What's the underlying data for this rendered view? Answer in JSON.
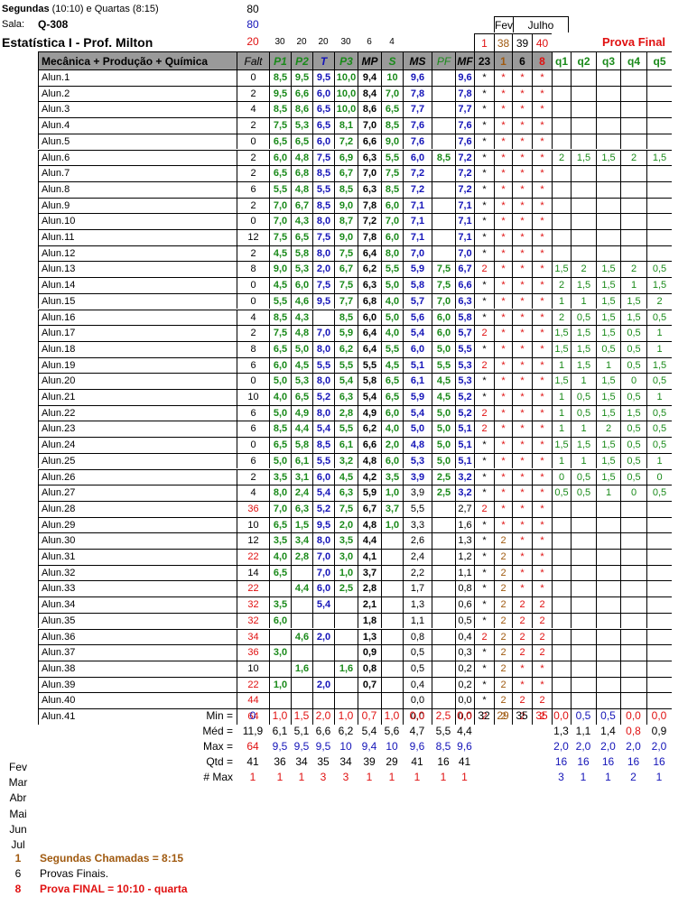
{
  "header": {
    "schedule_bold": "Segundas",
    "schedule_rest": "(10:10) e Quartas (8:15)",
    "hours": "80",
    "sala_label": "Sala:",
    "sala_value": "Q-308",
    "sala_count": "80",
    "course_title": "Estatística I - Prof. Milton",
    "course_count": "20",
    "weights": [
      "30",
      "20",
      "20",
      "30",
      "6",
      "4"
    ],
    "month_fev": "Fev",
    "month_jul": "Julho",
    "days": [
      "1",
      "38",
      "39",
      "40"
    ],
    "prova_final": "Prova Final",
    "class_name": "Mecânica + Produção + Química",
    "cols": [
      "Falt",
      "P1",
      "P2",
      "T",
      "P3",
      "MP",
      "S",
      "MS",
      "PF",
      "MF",
      "23",
      "1",
      "6",
      "8",
      "q1",
      "q2",
      "q3",
      "q4",
      "q5"
    ]
  },
  "students": [
    [
      "Alun.1",
      "0",
      "8,5",
      "9,5",
      "9,5",
      "10,0",
      "9,4",
      "10",
      "9,6",
      "",
      "9,6",
      "*",
      "*",
      "*",
      "*",
      "",
      "",
      "",
      "",
      ""
    ],
    [
      "Alun.2",
      "2",
      "9,5",
      "6,6",
      "6,0",
      "10,0",
      "8,4",
      "7,0",
      "7,8",
      "",
      "7,8",
      "*",
      "*",
      "*",
      "*",
      "",
      "",
      "",
      "",
      ""
    ],
    [
      "Alun.3",
      "4",
      "8,5",
      "8,6",
      "6,5",
      "10,0",
      "8,6",
      "6,5",
      "7,7",
      "",
      "7,7",
      "*",
      "*",
      "*",
      "*",
      "",
      "",
      "",
      "",
      ""
    ],
    [
      "Alun.4",
      "2",
      "7,5",
      "5,3",
      "6,5",
      "8,1",
      "7,0",
      "8,5",
      "7,6",
      "",
      "7,6",
      "*",
      "*",
      "*",
      "*",
      "",
      "",
      "",
      "",
      ""
    ],
    [
      "Alun.5",
      "0",
      "6,5",
      "6,5",
      "6,0",
      "7,2",
      "6,6",
      "9,0",
      "7,6",
      "",
      "7,6",
      "*",
      "*",
      "*",
      "*",
      "",
      "",
      "",
      "",
      ""
    ],
    [
      "Alun.6",
      "2",
      "6,0",
      "4,8",
      "7,5",
      "6,9",
      "6,3",
      "5,5",
      "6,0",
      "8,5",
      "7,2",
      "*",
      "*",
      "*",
      "*",
      "2",
      "1,5",
      "1,5",
      "2",
      "1,5"
    ],
    [
      "Alun.7",
      "2",
      "6,5",
      "6,8",
      "8,5",
      "6,7",
      "7,0",
      "7,5",
      "7,2",
      "",
      "7,2",
      "*",
      "*",
      "*",
      "*",
      "",
      "",
      "",
      "",
      ""
    ],
    [
      "Alun.8",
      "6",
      "5,5",
      "4,8",
      "5,5",
      "8,5",
      "6,3",
      "8,5",
      "7,2",
      "",
      "7,2",
      "*",
      "*",
      "*",
      "*",
      "",
      "",
      "",
      "",
      ""
    ],
    [
      "Alun.9",
      "2",
      "7,0",
      "6,7",
      "8,5",
      "9,0",
      "7,8",
      "6,0",
      "7,1",
      "",
      "7,1",
      "*",
      "*",
      "*",
      "*",
      "",
      "",
      "",
      "",
      ""
    ],
    [
      "Alun.10",
      "0",
      "7,0",
      "4,3",
      "8,0",
      "8,7",
      "7,2",
      "7,0",
      "7,1",
      "",
      "7,1",
      "*",
      "*",
      "*",
      "*",
      "",
      "",
      "",
      "",
      ""
    ],
    [
      "Alun.11",
      "12",
      "7,5",
      "6,5",
      "7,5",
      "9,0",
      "7,8",
      "6,0",
      "7,1",
      "",
      "7,1",
      "*",
      "*",
      "*",
      "*",
      "",
      "",
      "",
      "",
      ""
    ],
    [
      "Alun.12",
      "2",
      "4,5",
      "5,8",
      "8,0",
      "7,5",
      "6,4",
      "8,0",
      "7,0",
      "",
      "7,0",
      "*",
      "*",
      "*",
      "*",
      "",
      "",
      "",
      "",
      ""
    ],
    [
      "Alun.13",
      "8",
      "9,0",
      "5,3",
      "2,0",
      "6,7",
      "6,2",
      "5,5",
      "5,9",
      "7,5",
      "6,7",
      "2",
      "*",
      "*",
      "*",
      "1,5",
      "2",
      "1,5",
      "2",
      "0,5"
    ],
    [
      "Alun.14",
      "0",
      "4,5",
      "6,0",
      "7,5",
      "7,5",
      "6,3",
      "5,0",
      "5,8",
      "7,5",
      "6,6",
      "*",
      "*",
      "*",
      "*",
      "2",
      "1,5",
      "1,5",
      "1",
      "1,5"
    ],
    [
      "Alun.15",
      "0",
      "5,5",
      "4,6",
      "9,5",
      "7,7",
      "6,8",
      "4,0",
      "5,7",
      "7,0",
      "6,3",
      "*",
      "*",
      "*",
      "*",
      "1",
      "1",
      "1,5",
      "1,5",
      "2"
    ],
    [
      "Alun.16",
      "4",
      "8,5",
      "4,3",
      "",
      "8,5",
      "6,0",
      "5,0",
      "5,6",
      "6,0",
      "5,8",
      "*",
      "*",
      "*",
      "*",
      "2",
      "0,5",
      "1,5",
      "1,5",
      "0,5"
    ],
    [
      "Alun.17",
      "2",
      "7,5",
      "4,8",
      "7,0",
      "5,9",
      "6,4",
      "4,0",
      "5,4",
      "6,0",
      "5,7",
      "2",
      "*",
      "*",
      "*",
      "1,5",
      "1,5",
      "1,5",
      "0,5",
      "1"
    ],
    [
      "Alun.18",
      "8",
      "6,5",
      "5,0",
      "8,0",
      "6,2",
      "6,4",
      "5,5",
      "6,0",
      "5,0",
      "5,5",
      "*",
      "*",
      "*",
      "*",
      "1,5",
      "1,5",
      "0,5",
      "0,5",
      "1"
    ],
    [
      "Alun.19",
      "6",
      "6,0",
      "4,5",
      "5,5",
      "5,5",
      "5,5",
      "4,5",
      "5,1",
      "5,5",
      "5,3",
      "2",
      "*",
      "*",
      "*",
      "1",
      "1,5",
      "1",
      "0,5",
      "1,5"
    ],
    [
      "Alun.20",
      "0",
      "5,0",
      "5,3",
      "8,0",
      "5,4",
      "5,8",
      "6,5",
      "6,1",
      "4,5",
      "5,3",
      "*",
      "*",
      "*",
      "*",
      "1,5",
      "1",
      "1,5",
      "0",
      "0,5"
    ],
    [
      "Alun.21",
      "10",
      "4,0",
      "6,5",
      "5,2",
      "6,3",
      "5,4",
      "6,5",
      "5,9",
      "4,5",
      "5,2",
      "*",
      "*",
      "*",
      "*",
      "1",
      "0,5",
      "1,5",
      "0,5",
      "1"
    ],
    [
      "Alun.22",
      "6",
      "5,0",
      "4,9",
      "8,0",
      "2,8",
      "4,9",
      "6,0",
      "5,4",
      "5,0",
      "5,2",
      "2",
      "*",
      "*",
      "*",
      "1",
      "0,5",
      "1,5",
      "1,5",
      "0,5"
    ],
    [
      "Alun.23",
      "6",
      "8,5",
      "4,4",
      "5,4",
      "5,5",
      "6,2",
      "4,0",
      "5,0",
      "5,0",
      "5,1",
      "2",
      "*",
      "*",
      "*",
      "1",
      "1",
      "2",
      "0,5",
      "0,5"
    ],
    [
      "Alun.24",
      "0",
      "6,5",
      "5,8",
      "8,5",
      "6,1",
      "6,6",
      "2,0",
      "4,8",
      "5,0",
      "5,1",
      "*",
      "*",
      "*",
      "*",
      "1,5",
      "1,5",
      "1,5",
      "0,5",
      "0,5"
    ],
    [
      "Alun.25",
      "6",
      "5,0",
      "6,1",
      "5,5",
      "3,2",
      "4,8",
      "6,0",
      "5,3",
      "5,0",
      "5,1",
      "*",
      "*",
      "*",
      "*",
      "1",
      "1",
      "1,5",
      "0,5",
      "1"
    ],
    [
      "Alun.26",
      "2",
      "3,5",
      "3,1",
      "6,0",
      "4,5",
      "4,2",
      "3,5",
      "3,9",
      "2,5",
      "3,2",
      "*",
      "*",
      "*",
      "*",
      "0",
      "0,5",
      "1,5",
      "0,5",
      "0"
    ],
    [
      "Alun.27",
      "4",
      "8,0",
      "2,4",
      "5,4",
      "6,3",
      "5,9",
      "1,0",
      "3,9",
      "2,5",
      "3,2",
      "*",
      "*",
      "*",
      "*",
      "0,5",
      "0,5",
      "1",
      "0",
      "0,5"
    ],
    [
      "Alun.28",
      "36",
      "7,0",
      "6,3",
      "5,2",
      "7,5",
      "6,7",
      "3,7",
      "5,5",
      "",
      "2,7",
      "2",
      "*",
      "*",
      "*",
      "",
      "",
      "",
      "",
      ""
    ],
    [
      "Alun.29",
      "10",
      "6,5",
      "1,5",
      "9,5",
      "2,0",
      "4,8",
      "1,0",
      "3,3",
      "",
      "1,6",
      "*",
      "*",
      "*",
      "*",
      "",
      "",
      "",
      "",
      ""
    ],
    [
      "Alun.30",
      "12",
      "3,5",
      "3,4",
      "8,0",
      "3,5",
      "4,4",
      "",
      "2,6",
      "",
      "1,3",
      "*",
      "2",
      "*",
      "*",
      "",
      "",
      "",
      "",
      ""
    ],
    [
      "Alun.31",
      "22",
      "4,0",
      "2,8",
      "7,0",
      "3,0",
      "4,1",
      "",
      "2,4",
      "",
      "1,2",
      "*",
      "2",
      "*",
      "*",
      "",
      "",
      "",
      "",
      ""
    ],
    [
      "Alun.32",
      "14",
      "6,5",
      "",
      "7,0",
      "1,0",
      "3,7",
      "",
      "2,2",
      "",
      "1,1",
      "*",
      "2",
      "*",
      "*",
      "",
      "",
      "",
      "",
      ""
    ],
    [
      "Alun.33",
      "22",
      "",
      "4,4",
      "6,0",
      "2,5",
      "2,8",
      "",
      "1,7",
      "",
      "0,8",
      "*",
      "2",
      "*",
      "*",
      "",
      "",
      "",
      "",
      ""
    ],
    [
      "Alun.34",
      "32",
      "3,5",
      "",
      "5,4",
      "",
      "2,1",
      "",
      "1,3",
      "",
      "0,6",
      "*",
      "2",
      "2",
      "2",
      "",
      "",
      "",
      "",
      ""
    ],
    [
      "Alun.35",
      "32",
      "6,0",
      "",
      "",
      "",
      "1,8",
      "",
      "1,1",
      "",
      "0,5",
      "*",
      "2",
      "2",
      "2",
      "",
      "",
      "",
      "",
      ""
    ],
    [
      "Alun.36",
      "34",
      "",
      "4,6",
      "2,0",
      "",
      "1,3",
      "",
      "0,8",
      "",
      "0,4",
      "2",
      "2",
      "2",
      "2",
      "",
      "",
      "",
      "",
      ""
    ],
    [
      "Alun.37",
      "36",
      "3,0",
      "",
      "",
      "",
      "0,9",
      "",
      "0,5",
      "",
      "0,3",
      "*",
      "2",
      "2",
      "2",
      "",
      "",
      "",
      "",
      ""
    ],
    [
      "Alun.38",
      "10",
      "",
      "1,6",
      "",
      "1,6",
      "0,8",
      "",
      "0,5",
      "",
      "0,2",
      "*",
      "2",
      "*",
      "*",
      "",
      "",
      "",
      "",
      ""
    ],
    [
      "Alun.39",
      "22",
      "1,0",
      "",
      "2,0",
      "",
      "0,7",
      "",
      "0,4",
      "",
      "0,2",
      "*",
      "2",
      "*",
      "*",
      "",
      "",
      "",
      "",
      ""
    ],
    [
      "Alun.40",
      "44",
      "",
      "",
      "",
      "",
      "",
      "",
      "0,0",
      "",
      "0,0",
      "*",
      "2",
      "2",
      "2",
      "",
      "",
      "",
      "",
      ""
    ],
    [
      "Alun.41",
      "64",
      "",
      "",
      "",
      "",
      "",
      "",
      "0,0",
      "",
      "0,0",
      "2",
      "2",
      "2",
      "2",
      "",
      "",
      "",
      "",
      ""
    ]
  ],
  "stats": [
    {
      "label": "Min =",
      "vals": [
        "0",
        "1,0",
        "1,5",
        "2,0",
        "1,0",
        "0,7",
        "1,0",
        "0,0",
        "2,5",
        "0,0",
        "32",
        "29",
        "35",
        "35",
        "0,0",
        "0,5",
        "0,5",
        "0,0",
        "0,0"
      ]
    },
    {
      "label": "Méd =",
      "vals": [
        "11,9",
        "6,1",
        "5,1",
        "6,6",
        "6,2",
        "5,4",
        "5,6",
        "4,7",
        "5,5",
        "4,4",
        "",
        "",
        "",
        "",
        "1,3",
        "1,1",
        "1,4",
        "0,8",
        "0,9"
      ]
    },
    {
      "label": "Max =",
      "vals": [
        "64",
        "9,5",
        "9,5",
        "9,5",
        "10",
        "9,4",
        "10",
        "9,6",
        "8,5",
        "9,6",
        "",
        "",
        "",
        "",
        "2,0",
        "2,0",
        "2,0",
        "2,0",
        "2,0"
      ]
    },
    {
      "label": "Qtd =",
      "vals": [
        "41",
        "36",
        "34",
        "35",
        "34",
        "39",
        "29",
        "41",
        "16",
        "41",
        "",
        "",
        "",
        "",
        "16",
        "16",
        "16",
        "16",
        "16"
      ]
    },
    {
      "label": "# Max",
      "vals": [
        "1",
        "1",
        "1",
        "3",
        "3",
        "1",
        "1",
        "1",
        "1",
        "1",
        "",
        "",
        "",
        "",
        "3",
        "1",
        "1",
        "2",
        "1"
      ]
    }
  ],
  "months": [
    "Fev",
    "Mar",
    "Abr",
    "Mai",
    "Jun",
    "Jul"
  ],
  "notes": [
    {
      "num": "1",
      "text": "Segundas Chamadas = 8:15"
    },
    {
      "num": "6",
      "text": "Provas Finais."
    },
    {
      "num": "8",
      "text": "Prova FINAL = 10:10 - quarta"
    }
  ],
  "colors": {
    "green": "#1a8a1a",
    "blue": "#1414b8",
    "red": "#e01010",
    "brown": "#a05a10",
    "header_gray": "#9a9a9a"
  }
}
